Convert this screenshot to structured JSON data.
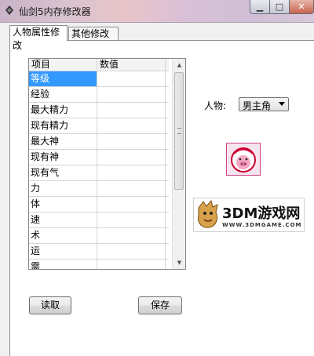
{
  "window": {
    "title": "仙剑5内存修改器"
  },
  "tabs": [
    {
      "label": "人物属性修改",
      "active": true
    },
    {
      "label": "其他修改",
      "active": false
    }
  ],
  "grid": {
    "columns": [
      "项目",
      "数值"
    ],
    "rows": [
      {
        "item": "等级",
        "value": ""
      },
      {
        "item": "经验",
        "value": ""
      },
      {
        "item": "最大精力",
        "value": ""
      },
      {
        "item": "现有精力",
        "value": ""
      },
      {
        "item": "最大神",
        "value": ""
      },
      {
        "item": "现有神",
        "value": ""
      },
      {
        "item": "现有气",
        "value": ""
      },
      {
        "item": "力",
        "value": ""
      },
      {
        "item": "体",
        "value": ""
      },
      {
        "item": "速",
        "value": ""
      },
      {
        "item": "术",
        "value": ""
      },
      {
        "item": "运",
        "value": ""
      },
      {
        "item": "需",
        "value": ""
      }
    ],
    "selected_index": 0
  },
  "character": {
    "label": "人物:",
    "selected": "男主角"
  },
  "logo": {
    "text": "3DM游戏网",
    "url": "WWW.3DMGAME.COM"
  },
  "buttons": {
    "read": "读取",
    "save": "保存"
  },
  "colors": {
    "selection": "#3399ff"
  }
}
